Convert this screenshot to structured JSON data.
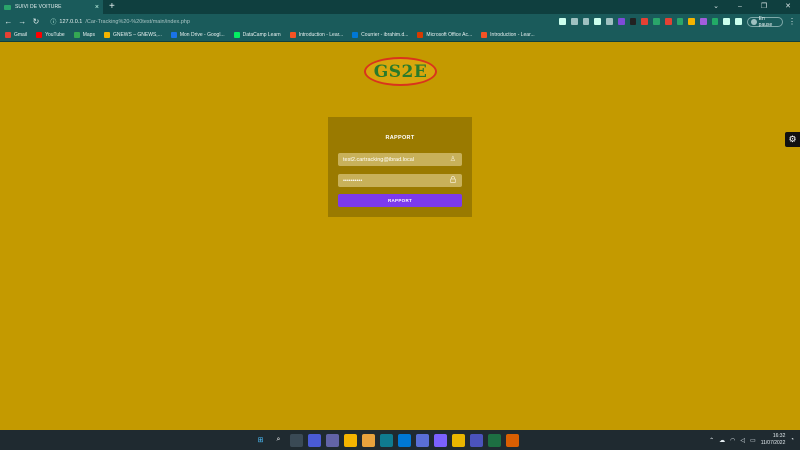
{
  "browser": {
    "tab_title": "SUIVI DE VOITURE",
    "tab_close": "×",
    "new_tab": "+",
    "url_host": "127.0.0.1",
    "url_path": "/Car-Tracking%20-%20test/main/index.php",
    "profile_status": "En pause",
    "window_controls": [
      "⌄",
      "–",
      "❐",
      "✕"
    ]
  },
  "bookmarks": [
    {
      "label": "Gmail",
      "color": "#e44134"
    },
    {
      "label": "YouTube",
      "color": "#ff0000"
    },
    {
      "label": "Maps",
      "color": "#34a853"
    },
    {
      "label": "GNEWS – GNEWS,...",
      "color": "#f4b400"
    },
    {
      "label": "Mon Drive - Googl...",
      "color": "#1a73e8"
    },
    {
      "label": "DataCamp Learn",
      "color": "#03ef62"
    },
    {
      "label": "Introduction - Lear...",
      "color": "#f35325"
    },
    {
      "label": "Courrier - ibrahim.d...",
      "color": "#0078d4"
    },
    {
      "label": "Microsoft Office Ac...",
      "color": "#d83b01"
    },
    {
      "label": "Introduction - Lear...",
      "color": "#f35325"
    }
  ],
  "logo": {
    "text": "GS2E"
  },
  "report_form": {
    "title": "RAPPORT",
    "email_value": "test2.cartracking@ibrad.local",
    "password_value": "••••••••••",
    "submit_label": "RAPPORT"
  },
  "icons": {
    "user_icon": "♙",
    "lock_icon": "🔒",
    "gear_icon": "⚙"
  },
  "colors": {
    "page_bg": "#c49a00",
    "card_bg": "#9a7a00",
    "button": "#7c3aed"
  },
  "taskbar": {
    "time": "16:32",
    "date": "11/07/2022"
  }
}
